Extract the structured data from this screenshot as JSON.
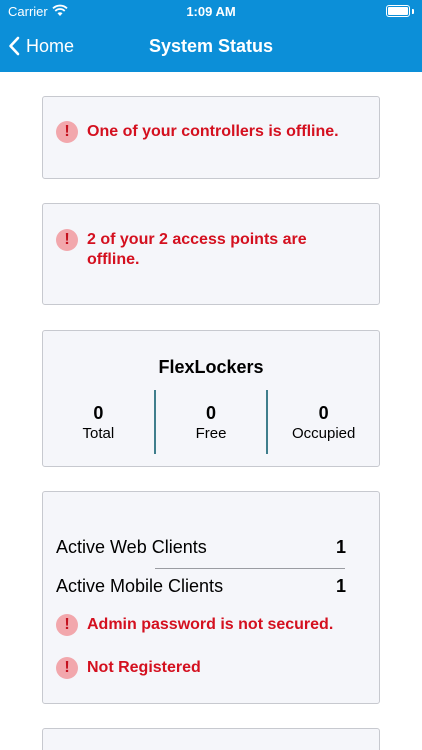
{
  "status_bar": {
    "carrier": "Carrier",
    "time": "1:09 AM"
  },
  "nav": {
    "back_label": "Home",
    "title": "System Status"
  },
  "alerts": [
    {
      "text": "One of your controllers is offline."
    },
    {
      "text": "2 of your 2 access points are offline."
    }
  ],
  "flexlockers": {
    "title": "FlexLockers",
    "stats": [
      {
        "value": "0",
        "label": "Total"
      },
      {
        "value": "0",
        "label": "Free"
      },
      {
        "value": "0",
        "label": "Occupied"
      }
    ]
  },
  "clients": {
    "rows": [
      {
        "label": "Active Web Clients",
        "value": "1"
      },
      {
        "label": "Active Mobile Clients",
        "value": "1"
      }
    ],
    "alerts": [
      {
        "text": "Admin password is not secured."
      },
      {
        "text": "Not Registered"
      }
    ]
  },
  "icons": {
    "alert": "!"
  },
  "colors": {
    "header": "#0c8fd8",
    "alert_text": "#d4101f",
    "divider": "#3f7e8c"
  }
}
